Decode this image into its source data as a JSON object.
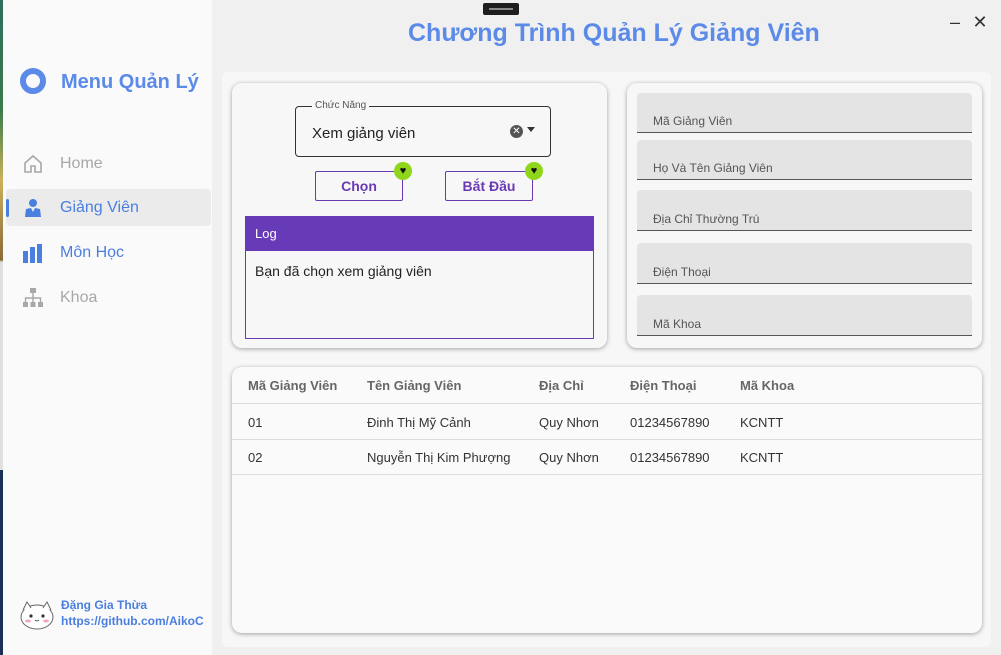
{
  "window": {
    "title": "Chương Trình Quản Lý Giảng Viên",
    "min_icon": "minimize-icon",
    "close_icon": "close-icon"
  },
  "sidebar": {
    "title": "Menu Quản Lý",
    "items": [
      {
        "label": "Home",
        "icon": "home-icon",
        "active": false
      },
      {
        "label": "Giảng Viên",
        "icon": "teacher-icon",
        "active": true
      },
      {
        "label": "Môn Học",
        "icon": "bar-chart-icon",
        "active": false
      },
      {
        "label": "Khoa",
        "icon": "org-chart-icon",
        "active": false
      }
    ],
    "footer": {
      "name": "Đặng Gia Thừa",
      "link": "https://github.com/AikoC"
    }
  },
  "function_panel": {
    "combo_label": "Chức Năng",
    "combo_value": "Xem giảng viên",
    "choose_button": "Chọn",
    "start_button": "Bắt Đầu",
    "log_title": "Log",
    "log_text": "Bạn đã chọn xem giảng viên"
  },
  "form": {
    "fields": [
      {
        "placeholder": "Mã Giảng Viên"
      },
      {
        "placeholder": "Họ Và Tên Giảng Viên"
      },
      {
        "placeholder": "Địa Chỉ Thường Trú"
      },
      {
        "placeholder": "Điện Thoại"
      },
      {
        "placeholder": "Mã Khoa"
      }
    ]
  },
  "table": {
    "columns": [
      "Mã Giảng Viên",
      "Tên Giảng Viên",
      "Địa Chỉ",
      "Điện Thoại",
      "Mã Khoa"
    ],
    "rows": [
      [
        "01",
        "Đinh Thị Mỹ Cảnh",
        "Quy Nhơn",
        "01234567890",
        "KCNTT"
      ],
      [
        "02",
        "Nguyễn Thị Kim Phượng",
        "Quy Nhơn",
        "01234567890",
        "KCNTT"
      ]
    ]
  },
  "colors": {
    "accent": "#5b8ae8",
    "purple": "#673ab7",
    "badge": "#8fd61a"
  }
}
